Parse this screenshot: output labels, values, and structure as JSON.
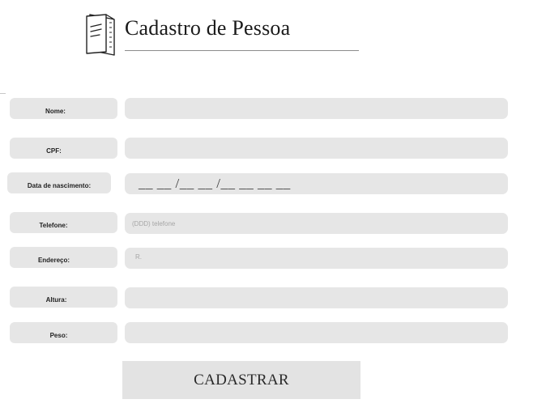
{
  "header": {
    "title": "Cadastro de Pessoa",
    "icon": "folder-document-icon"
  },
  "form": {
    "fields": [
      {
        "label": "Nome:",
        "value": "",
        "placeholder": ""
      },
      {
        "label": "CPF:",
        "value": "",
        "placeholder": ""
      },
      {
        "label": "Data de nascimento:",
        "value": "__ __ /__ __ /__ __ __ __",
        "placeholder": ""
      },
      {
        "label": "Telefone:",
        "value": "",
        "placeholder": "(DDD) telefone"
      },
      {
        "label": "Endereço:",
        "value": "R.",
        "placeholder": ""
      },
      {
        "label": "Altura:",
        "value": "",
        "placeholder": ""
      },
      {
        "label": "Peso:",
        "value": "",
        "placeholder": ""
      }
    ],
    "submit_label": "CADASTRAR"
  },
  "colors": {
    "field_background": "#e6e6e6",
    "button_background": "#e3e3e3",
    "text": "#1f1f1f",
    "placeholder": "#a6a6a6"
  }
}
